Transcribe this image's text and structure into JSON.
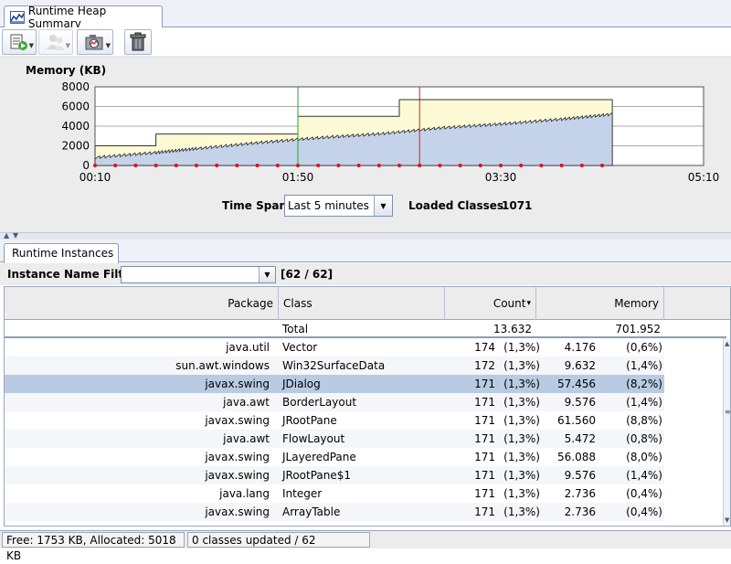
{
  "window": {
    "tab_title": "Runtime Heap Summary",
    "icon": "heap-chart-icon"
  },
  "toolbar": {
    "buttons": [
      {
        "name": "export-button",
        "icon": "export-icon",
        "has_dropdown": true,
        "enabled": true
      },
      {
        "name": "users-button",
        "icon": "users-icon",
        "has_dropdown": true,
        "enabled": false
      },
      {
        "name": "snapshot-button",
        "icon": "camera-icon",
        "has_dropdown": true,
        "enabled": true
      },
      {
        "name": "gc-button",
        "icon": "trash-can-icon",
        "has_dropdown": false,
        "enabled": true
      }
    ]
  },
  "chart": {
    "title": "Memory (KB)",
    "y_ticks": [
      "8000",
      "6000",
      "4000",
      "2000",
      "0"
    ],
    "x_ticks": [
      "00:10",
      "01:50",
      "03:30",
      "05:10"
    ]
  },
  "chart_data": {
    "type": "area",
    "title": "Memory (KB)",
    "xlabel": "",
    "ylabel": "Memory (KB)",
    "ylim": [
      0,
      8000
    ],
    "x_ticks": [
      "00:10",
      "01:50",
      "03:30",
      "05:10"
    ],
    "grid": true,
    "series": [
      {
        "x": [
          "00:10",
          "00:40",
          "00:40",
          "01:50",
          "01:50",
          "02:40",
          "02:40",
          "04:25"
        ],
        "values": [
          2000,
          2000,
          3200,
          3200,
          5000,
          5000,
          6700,
          6700
        ],
        "color": "#fdfbd6"
      },
      {
        "x": [
          "00:10",
          "00:40",
          "01:00",
          "01:30",
          "02:00",
          "02:30",
          "03:00",
          "03:30",
          "04:00",
          "04:25"
        ],
        "values": [
          800,
          1300,
          1700,
          2300,
          2800,
          3200,
          3800,
          4200,
          4700,
          5200
        ],
        "color": "#c4d3ea"
      }
    ],
    "markers": [
      {
        "x": "01:50",
        "color": "#2aa02a"
      },
      {
        "x": "02:50",
        "color": "#d21f1f"
      }
    ]
  },
  "controls": {
    "timespan_label": "Time Span:",
    "timespan_value": "Last 5 minutes",
    "loaded_label": "Loaded Classes:",
    "loaded_value": "1071"
  },
  "instances": {
    "tab_title": "Runtime Instances",
    "filter_label": "Instance Name Filter:",
    "filter_value": "",
    "filter_count": "[62 / 62]",
    "columns": {
      "package": "Package",
      "class": "Class",
      "count": "Count",
      "memory": "Memory"
    },
    "sort_indicator": "▾",
    "total": {
      "label": "Total",
      "count": "13.632",
      "memory": "701.952"
    },
    "rows": [
      {
        "package": "java.util",
        "class": "Vector",
        "count": "174",
        "count_pct": "(1,3%)",
        "memory": "4.176",
        "memory_pct": "(0,6%)",
        "selected": false
      },
      {
        "package": "sun.awt.windows",
        "class": "Win32SurfaceData",
        "count": "172",
        "count_pct": "(1,3%)",
        "memory": "9.632",
        "memory_pct": "(1,4%)",
        "selected": false
      },
      {
        "package": "javax.swing",
        "class": "JDialog",
        "count": "171",
        "count_pct": "(1,3%)",
        "memory": "57.456",
        "memory_pct": "(8,2%)",
        "selected": true
      },
      {
        "package": "java.awt",
        "class": "BorderLayout",
        "count": "171",
        "count_pct": "(1,3%)",
        "memory": "9.576",
        "memory_pct": "(1,4%)",
        "selected": false
      },
      {
        "package": "javax.swing",
        "class": "JRootPane",
        "count": "171",
        "count_pct": "(1,3%)",
        "memory": "61.560",
        "memory_pct": "(8,8%)",
        "selected": false
      },
      {
        "package": "java.awt",
        "class": "FlowLayout",
        "count": "171",
        "count_pct": "(1,3%)",
        "memory": "5.472",
        "memory_pct": "(0,8%)",
        "selected": false
      },
      {
        "package": "javax.swing",
        "class": "JLayeredPane",
        "count": "171",
        "count_pct": "(1,3%)",
        "memory": "56.088",
        "memory_pct": "(8,0%)",
        "selected": false
      },
      {
        "package": "javax.swing",
        "class": "JRootPane$1",
        "count": "171",
        "count_pct": "(1,3%)",
        "memory": "9.576",
        "memory_pct": "(1,4%)",
        "selected": false
      },
      {
        "package": "java.lang",
        "class": "Integer",
        "count": "171",
        "count_pct": "(1,3%)",
        "memory": "2.736",
        "memory_pct": "(0,4%)",
        "selected": false
      },
      {
        "package": "javax.swing",
        "class": "ArrayTable",
        "count": "171",
        "count_pct": "(1,3%)",
        "memory": "2.736",
        "memory_pct": "(0,4%)",
        "selected": false
      }
    ]
  },
  "status": {
    "memory": "Free: 1753 KB, Allocated: 5018 KB",
    "classes": "0 classes updated / 62"
  }
}
